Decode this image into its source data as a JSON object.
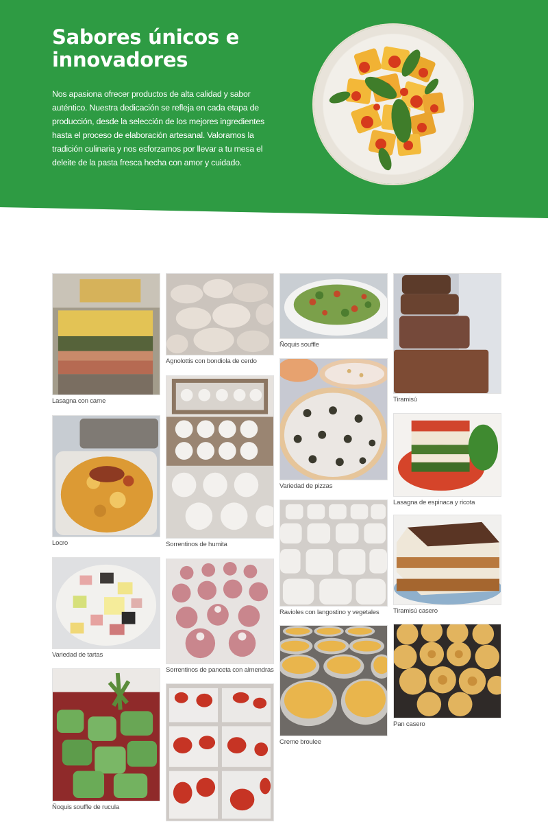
{
  "hero": {
    "title": "Sabores únicos e innovadores",
    "description": "Nos apasiona ofrecer productos de alta calidad y sabor auténtico. Nuestra dedicación se refleja en cada etapa de producción, desde la selección de los mejores ingredientes hasta el proceso de elaboración artesanal. Valoramos la tradición culinaria y nos esforzamos por llevar a tu mesa el deleite de la pasta fresca hecha con amor y cuidado.",
    "background_color": "#2e9b43"
  },
  "gallery": {
    "items": [
      {
        "caption": "Lasagna con carne"
      },
      {
        "caption": "Agnolottis con bondiola de cerdo"
      },
      {
        "caption": "Ñoquis souffle"
      },
      {
        "caption": "Tiramisú"
      },
      {
        "caption": "Variedad de pizzas"
      },
      {
        "caption": "Locro"
      },
      {
        "caption": "Sorrentinos de humita"
      },
      {
        "caption": "Lasagna de espinaca y ricota"
      },
      {
        "caption": "Ravioles con langostino y vegetales"
      },
      {
        "caption": "Tiramisú casero"
      },
      {
        "caption": "Variedad de tartas"
      },
      {
        "caption": "Sorrentinos de panceta con almendras"
      },
      {
        "caption": "Creme broulee"
      },
      {
        "caption": "Pan casero"
      },
      {
        "caption": "Ñoquis souffle de rucula"
      },
      {
        "caption": ""
      }
    ]
  }
}
